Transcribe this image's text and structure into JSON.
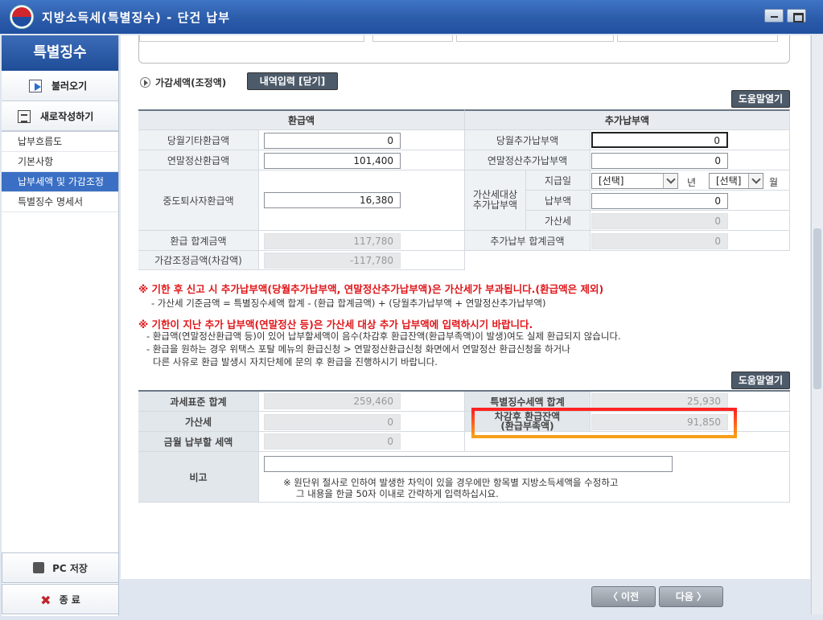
{
  "window": {
    "title": "지방소득세(특별징수) - 단건 납부"
  },
  "sidebar": {
    "header": "특별징수",
    "load_button": "불러오기",
    "new_button": "새로작성하기",
    "items": [
      {
        "label": "납부흐름도",
        "active": false
      },
      {
        "label": "기본사항",
        "active": false
      },
      {
        "label": "납부세액 및 가감조정",
        "active": true
      },
      {
        "label": "특별징수 명세서",
        "active": false
      }
    ],
    "pc_save": "PC 저장",
    "exit": "종 료"
  },
  "section": {
    "title": "가감세액(조정액)",
    "detail_button": "내역입력 [닫기]",
    "help_button": "도움말열기"
  },
  "refund": {
    "header": "환급액",
    "other_refund_label": "당월기타환급액",
    "other_refund_value": "0",
    "yearend_refund_label": "연말정산환급액",
    "yearend_refund_value": "101,400",
    "retire_refund_label": "중도퇴사자환급액",
    "retire_refund_value": "16,380",
    "total_label": "환급 합계금액",
    "total_value": "117,780",
    "adjust_label": "가감조정금액(차감액)",
    "adjust_value": "-117,780"
  },
  "additional": {
    "header": "추가납부액",
    "month_add_label": "당월추가납부액",
    "month_add_value": "0",
    "yearend_add_label": "연말정산추가납부액",
    "yearend_add_value": "0",
    "penalty_group_label": "가산세대상\n추가납부액",
    "pay_date_label": "지급일",
    "year_select": "[선택]",
    "year_unit": "년",
    "month_select": "[선택]",
    "month_unit": "월",
    "pay_amount_label": "납부액",
    "pay_amount_value": "0",
    "penalty_label": "가산세",
    "penalty_value": "0",
    "total_label": "추가납부 합계금액",
    "total_value": "0"
  },
  "notes": {
    "red1": "※ 기한 후 신고 시 추가납부액(당월추가납부액, 연말정산추가납부액)은 가산세가 부과됩니다.(환급액은 제외)",
    "line1": "- 가산세 기준금액 = 특별징수세액 합계 - (환급 합계금액) + (당월추가납부액 + 연말정산추가납부액)",
    "red2": "※ 기한이 지난 추가 납부액(연말정산 등)은 가산세 대상 추가 납부액에 입력하시기 바랍니다.",
    "line2": "- 환급액(연말정산환급액 등)이 있어 납부할세액이 음수(차감후 환급잔액(환급부족액)이 발생)여도 실제 환급되지 않습니다.",
    "line3": "- 환급을 원하는 경우 위택스 포탈 메뉴의 환급신청 > 연말정산환급신청 화면에서 연말정산 환급신청을 하거나",
    "line4": "다른 사유로 환급 발생시 자치단체에 문의 후 환급을 진행하시기 바랍니다."
  },
  "summary": {
    "help_button": "도움말열기",
    "tax_base_label": "과세표준 합계",
    "tax_base_value": "259,460",
    "special_total_label": "특별징수세액 합계",
    "special_total_value": "25,930",
    "penalty_label": "가산세",
    "penalty_value": "0",
    "balance_label_1": "차감후 환급잔액",
    "balance_label_2": "(환급부족액)",
    "balance_value": "91,850",
    "month_pay_label": "금월 납부할 세액",
    "month_pay_value": "0",
    "remark_label": "비고",
    "remark_value": "",
    "remark_note_1": "※ 원단위 절사로 인하여 발생한 차익이 있을 경우에만 항목별 지방소득세액을 수정하고",
    "remark_note_2": "그 내용을 한글 50자 이내로 간략하게 입력하십시요."
  },
  "nav": {
    "prev": "〈 이전",
    "next": "다음 〉"
  },
  "colors": {
    "accent": "#3a6fc4",
    "warning": "#e0161a",
    "highlight": "#f7a01a"
  }
}
